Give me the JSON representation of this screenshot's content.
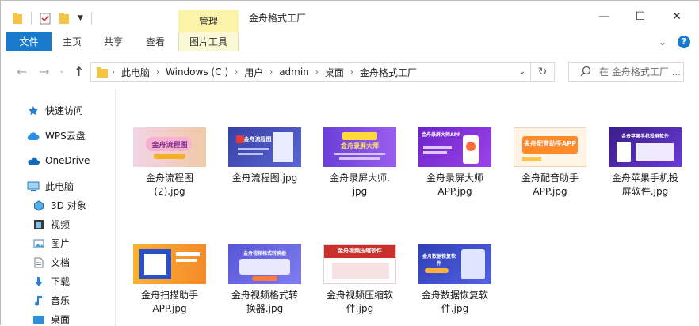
{
  "title_bar": {
    "context_tab": "管理",
    "window_title": "金舟格式工厂",
    "controls": {
      "minimize": "—",
      "maximize": "☐",
      "close": "✕"
    }
  },
  "ribbon": {
    "tabs": [
      {
        "label": "文件",
        "active": true
      },
      {
        "label": "主页"
      },
      {
        "label": "共享"
      },
      {
        "label": "查看"
      },
      {
        "label": "图片工具"
      }
    ]
  },
  "address_bar": {
    "breadcrumbs": [
      "此电脑",
      "Windows (C:)",
      "用户",
      "admin",
      "桌面",
      "金舟格式工厂"
    ]
  },
  "search": {
    "placeholder": "在 金舟格式工厂 ..."
  },
  "nav_pane": {
    "items": [
      {
        "label": "快速访问",
        "icon": "star-icon"
      },
      {
        "label": "WPS云盘",
        "icon": "cloud-icon"
      },
      {
        "label": "OneDrive",
        "icon": "onedrive-icon"
      },
      {
        "label": "此电脑",
        "icon": "computer-icon"
      },
      {
        "label": "3D 对象",
        "icon": "cube-icon"
      },
      {
        "label": "视频",
        "icon": "film-icon"
      },
      {
        "label": "图片",
        "icon": "picture-icon"
      },
      {
        "label": "文档",
        "icon": "document-icon"
      },
      {
        "label": "下载",
        "icon": "download-icon"
      },
      {
        "label": "音乐",
        "icon": "music-icon"
      },
      {
        "label": "桌面",
        "icon": "desktop-icon"
      }
    ]
  },
  "files": [
    {
      "name": "金舟流程图\n(2).jpg",
      "thumb_text": "金舟流程图"
    },
    {
      "name": "金舟流程图.jpg",
      "thumb_text": "金舟流程图"
    },
    {
      "name": "金舟录屏大师.\njpg",
      "thumb_text": "金舟录屏大师"
    },
    {
      "name": "金舟录屏大师\nAPP.jpg",
      "thumb_text": "金舟录屏大师APP"
    },
    {
      "name": "金舟配音助手\nAPP.jpg",
      "thumb_text": "金舟配音助手APP"
    },
    {
      "name": "金舟苹果手机投\n屏软件.jpg",
      "thumb_text": "金舟苹果手机投屏软件"
    },
    {
      "name": "金舟扫描助手\nAPP.jpg",
      "thumb_text": ""
    },
    {
      "name": "金舟视频格式转\n换器.jpg",
      "thumb_text": "金舟视频格式转换器"
    },
    {
      "name": "金舟视频压缩软\n件.jpg",
      "thumb_text": "金舟视频压缩软件"
    },
    {
      "name": "金舟数据恢复软\n件.jpg",
      "thumb_text": "金舟数据恢复软件"
    }
  ],
  "colors": {
    "accent": "#1979ca",
    "context_tab": "#fbf3a8",
    "folder": "#f6c445"
  }
}
